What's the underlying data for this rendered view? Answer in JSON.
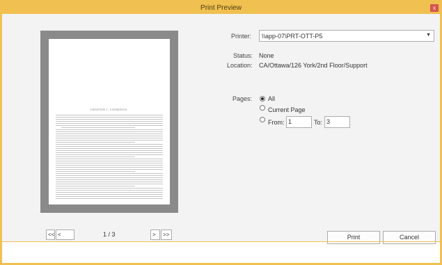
{
  "window": {
    "title": "Print Preview",
    "close_label": "x"
  },
  "settings": {
    "printer_label": "Printer:",
    "printer_value": "\\\\app-07\\PRT-OTT-P5",
    "status_label": "Status:",
    "status_value": "None",
    "location_label": "Location:",
    "location_value": "CA/Ottawa/126 York/2nd Floor/Support"
  },
  "pages": {
    "label": "Pages:",
    "all_label": "All",
    "current_label": "Current Page",
    "from_label": "From:",
    "from_value": "1",
    "to_label": "To:",
    "to_value": "3",
    "selected": "all"
  },
  "preview": {
    "chapter_heading": "CHAPTER I. LOOMINGS."
  },
  "navigation": {
    "first_label": "<<",
    "prev_label": "<",
    "page_indicator": "1 / 3",
    "next_label": ">",
    "last_label": ">>"
  },
  "actions": {
    "print_label": "Print",
    "cancel_label": "Cancel"
  }
}
